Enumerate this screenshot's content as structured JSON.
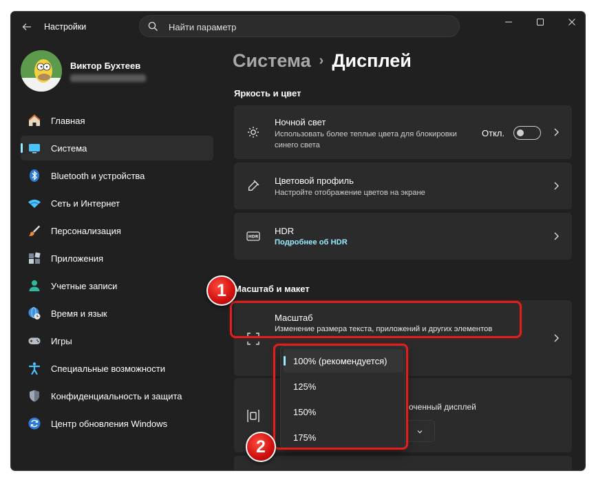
{
  "app": {
    "title": "Настройки"
  },
  "search": {
    "placeholder": "Найти параметр"
  },
  "profile": {
    "name": "Виктор Бухтеев"
  },
  "nav": {
    "items": [
      {
        "label": "Главная",
        "icon": "home-icon"
      },
      {
        "label": "Система",
        "icon": "system-icon",
        "active": true
      },
      {
        "label": "Bluetooth и устройства",
        "icon": "bluetooth-icon"
      },
      {
        "label": "Сеть и Интернет",
        "icon": "wifi-icon"
      },
      {
        "label": "Персонализация",
        "icon": "brush-icon"
      },
      {
        "label": "Приложения",
        "icon": "apps-icon"
      },
      {
        "label": "Учетные записи",
        "icon": "person-icon"
      },
      {
        "label": "Время и язык",
        "icon": "globe-clock-icon"
      },
      {
        "label": "Игры",
        "icon": "gamepad-icon"
      },
      {
        "label": "Специальные возможности",
        "icon": "accessibility-icon"
      },
      {
        "label": "Конфиденциальность и защита",
        "icon": "shield-icon"
      },
      {
        "label": "Центр обновления Windows",
        "icon": "update-icon"
      }
    ]
  },
  "breadcrumb": {
    "parent": "Система",
    "separator": "›",
    "current": "Дисплей"
  },
  "sections": {
    "brightness": {
      "title": "Яркость и цвет"
    },
    "scale": {
      "title": "Масштаб и макет"
    }
  },
  "cards": {
    "night_light": {
      "title": "Ночной свет",
      "subtitle": "Использовать более теплые цвета для блокировки синего света",
      "toggle_label": "Откл.",
      "toggle_on": false
    },
    "color_profile": {
      "title": "Цветовой профиль",
      "subtitle": "Настройте отображение цветов на экране"
    },
    "hdr": {
      "title": "HDR",
      "link": "Подробнее об HDR"
    },
    "scale": {
      "title": "Масштаб",
      "subtitle": "Изменение размера текста, приложений и других элементов"
    },
    "resolution": {
      "partial_text": "оченный дисплей"
    }
  },
  "scale_dropdown": {
    "options": [
      "100% (рекомендуется)",
      "125%",
      "150%",
      "175%"
    ],
    "selected_index": 0
  },
  "annotations": {
    "badge_1": "1",
    "badge_2": "2",
    "color": "#e02020"
  },
  "colors": {
    "accent": "#99ebff",
    "background": "#202020",
    "card": "#2b2b2b"
  }
}
